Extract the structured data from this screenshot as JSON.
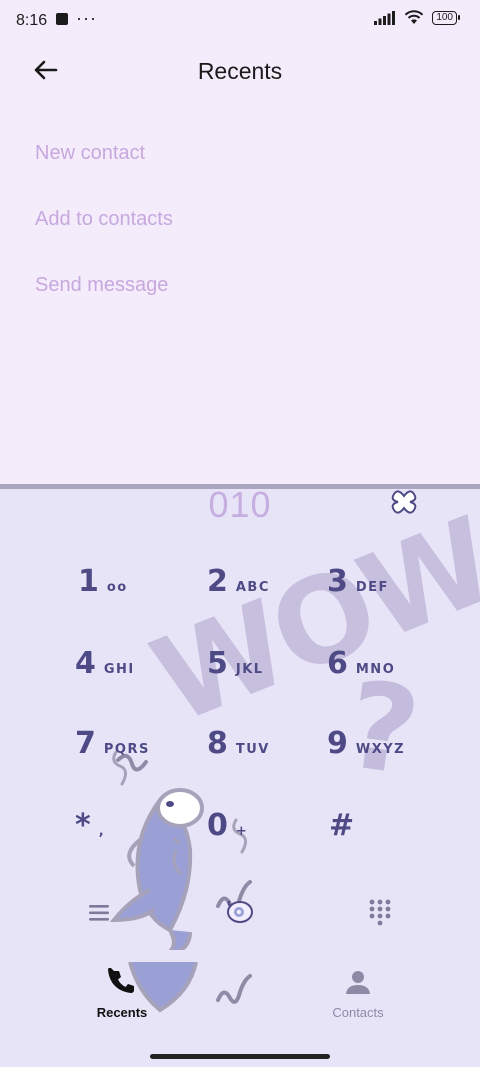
{
  "status_bar": {
    "time": "8:16",
    "dots": "···",
    "battery": "100"
  },
  "header": {
    "title": "Recents",
    "back_icon": "arrow-left-icon"
  },
  "menu": {
    "items": [
      "New contact",
      "Add to contacts",
      "Send message"
    ]
  },
  "dialer": {
    "number": "010",
    "clear_icon": "backspace-icon",
    "keys": [
      {
        "digit": "1",
        "letters": "oo"
      },
      {
        "digit": "2",
        "letters": "ABC"
      },
      {
        "digit": "3",
        "letters": "DEF"
      },
      {
        "digit": "4",
        "letters": "GHI"
      },
      {
        "digit": "5",
        "letters": "JKL"
      },
      {
        "digit": "6",
        "letters": "MNO"
      },
      {
        "digit": "7",
        "letters": "PQRS"
      },
      {
        "digit": "8",
        "letters": "TUV"
      },
      {
        "digit": "9",
        "letters": "WXYZ"
      },
      {
        "digit": "*",
        "letters": ","
      },
      {
        "digit": "0",
        "letters": "+"
      },
      {
        "digit": "#",
        "letters": ""
      }
    ],
    "decor": {
      "wow": "WOW",
      "question": "?"
    }
  },
  "toolbar": {
    "menu_icon": "hamburger-menu-icon",
    "call_icon": "call-button-icon",
    "keypad_icon": "dialpad-icon"
  },
  "bottom_nav": {
    "tabs": [
      {
        "label": "Recents",
        "icon": "phone-icon",
        "active": true
      },
      {
        "label": "Contacts",
        "icon": "person-icon",
        "active": false
      }
    ]
  },
  "colors": {
    "background": "#f4ecfb",
    "dial_panel": "#e8e4f8",
    "menu_text": "#c7a8de",
    "key_text": "#4e4a86",
    "decor": "#c4bcdc"
  }
}
